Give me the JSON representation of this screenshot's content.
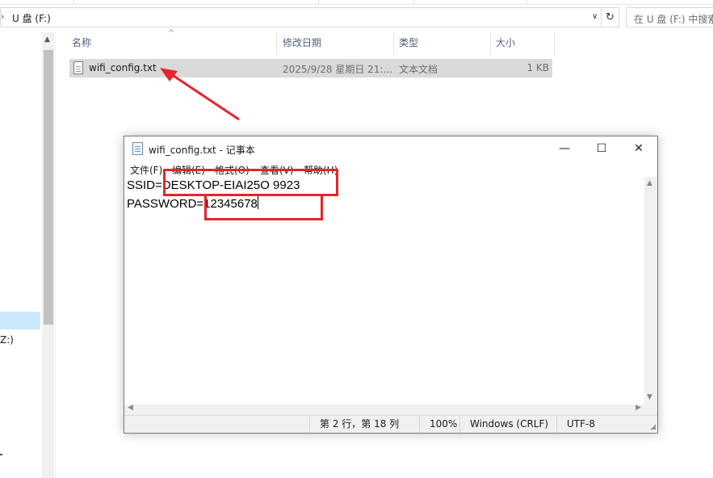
{
  "explorer": {
    "address": {
      "chevron": "›",
      "path": "U 盘 (F:)",
      "dropdown": "∨",
      "refresh": "↻"
    },
    "search_placeholder": "在 U 盘 (F:) 中搜索",
    "nav": {
      "drive_label": "Z:)"
    },
    "columns": [
      {
        "label": "名称"
      },
      {
        "label": "修改日期"
      },
      {
        "label": "类型"
      },
      {
        "label": "大小"
      }
    ],
    "sort_indicator": "^",
    "files": [
      {
        "name": "wifi_config.txt",
        "modified": "2025/9/28 星期日 21:...",
        "type": "文本文档",
        "size": "1 KB"
      }
    ]
  },
  "notepad": {
    "title": "wifi_config.txt - 记事本",
    "window_buttons": {
      "minimize": "—",
      "maximize": "☐",
      "close": "✕"
    },
    "menu": [
      "文件(F)",
      "编辑(E)",
      "格式(O)",
      "查看(V)",
      "帮助(H)"
    ],
    "content": {
      "line1": "SSID=DESKTOP-EIAI25O 9923",
      "line2": "PASSWORD=12345678"
    },
    "status": {
      "position": "第 2 行，第 18 列",
      "zoom": "100%",
      "line_ending": "Windows (CRLF)",
      "encoding": "UTF-8"
    }
  },
  "annotation_color": "#e5252b"
}
